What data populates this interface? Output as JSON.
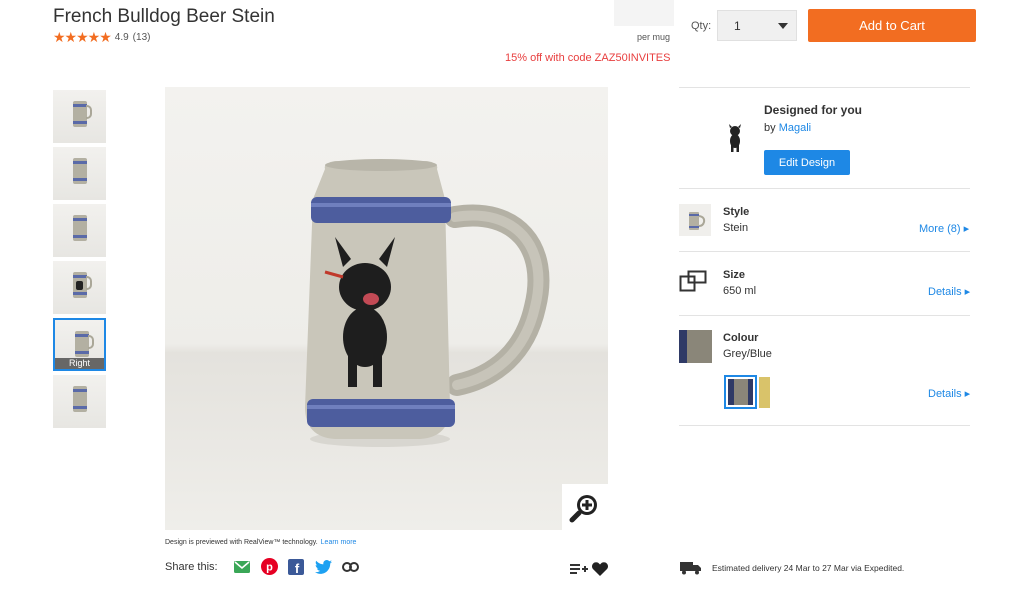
{
  "product": {
    "title": "French Bulldog Beer Stein",
    "rating": "4.9",
    "review_count": "(13)",
    "stars": "★★★★★",
    "per_unit": "per mug",
    "promo": "15% off with code ZAZ50INVITES"
  },
  "purchase": {
    "qty_label": "Qty:",
    "qty_value": "1",
    "add_to_cart": "Add to Cart"
  },
  "thumbnails": [
    {
      "label": ""
    },
    {
      "label": ""
    },
    {
      "label": ""
    },
    {
      "label": ""
    },
    {
      "label": "Right"
    },
    {
      "label": ""
    }
  ],
  "viewer": {
    "realview_text": "Design is previewed with RealView™ technology.",
    "learn_more": "Learn more",
    "share_label": "Share this:"
  },
  "designer": {
    "title": "Designed for you",
    "by": "by",
    "name": "Magali",
    "edit_button": "Edit Design"
  },
  "options": {
    "style": {
      "label": "Style",
      "value": "Stein",
      "link": "More (8) ▸"
    },
    "size": {
      "label": "Size",
      "value": "650 ml",
      "link": "Details ▸"
    },
    "colour": {
      "label": "Colour",
      "value": "Grey/Blue",
      "link": "Details ▸"
    }
  },
  "delivery": {
    "text": "Estimated delivery 24 Mar to 27 Mar via Expedited."
  },
  "colors": {
    "accent": "#f26d21",
    "link": "#1e88e5",
    "promo": "#e83e3e",
    "swatch_grey": "#8a8679",
    "swatch_blue": "#2f3a66",
    "swatch_gold": "#d9c36a"
  }
}
